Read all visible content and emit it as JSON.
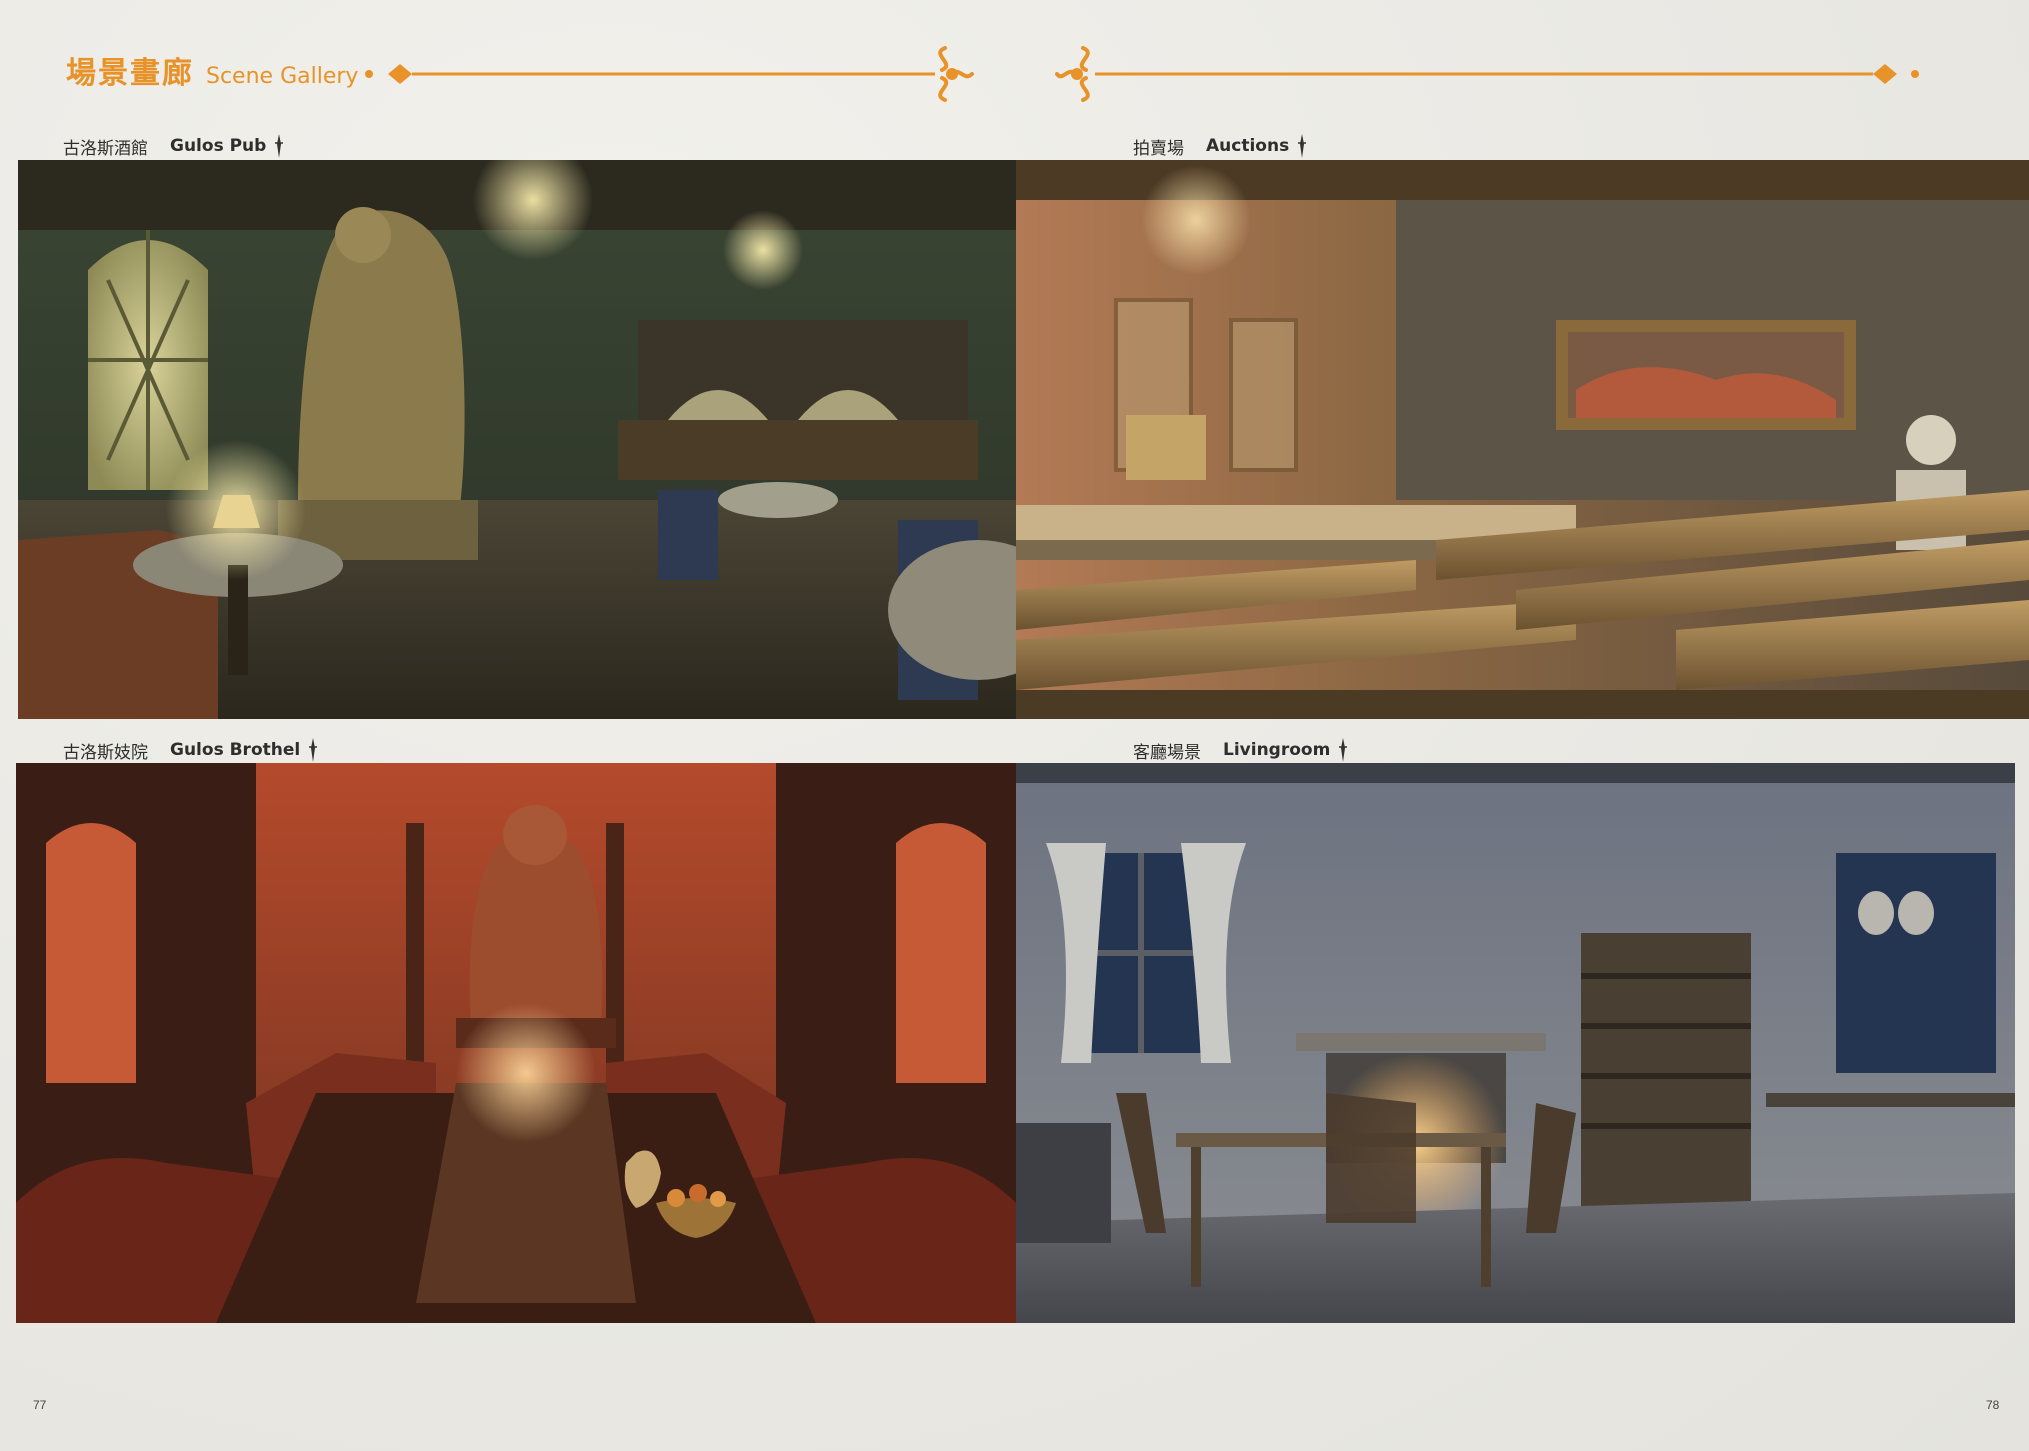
{
  "header": {
    "title_cn": "場景畫廊",
    "title_en": "Scene Gallery"
  },
  "colors": {
    "accent": "#e8922a",
    "paper": "#ecebe6"
  },
  "scenes": [
    {
      "label_cn": "古洛斯酒館",
      "label_en": "Gulos Pub"
    },
    {
      "label_cn": "拍賣場",
      "label_en": "Auctions"
    },
    {
      "label_cn": "古洛斯妓院",
      "label_en": "Gulos Brothel"
    },
    {
      "label_cn": "客廳場景",
      "label_en": "Livingroom"
    }
  ],
  "pages": {
    "left": "77",
    "right": "78"
  }
}
